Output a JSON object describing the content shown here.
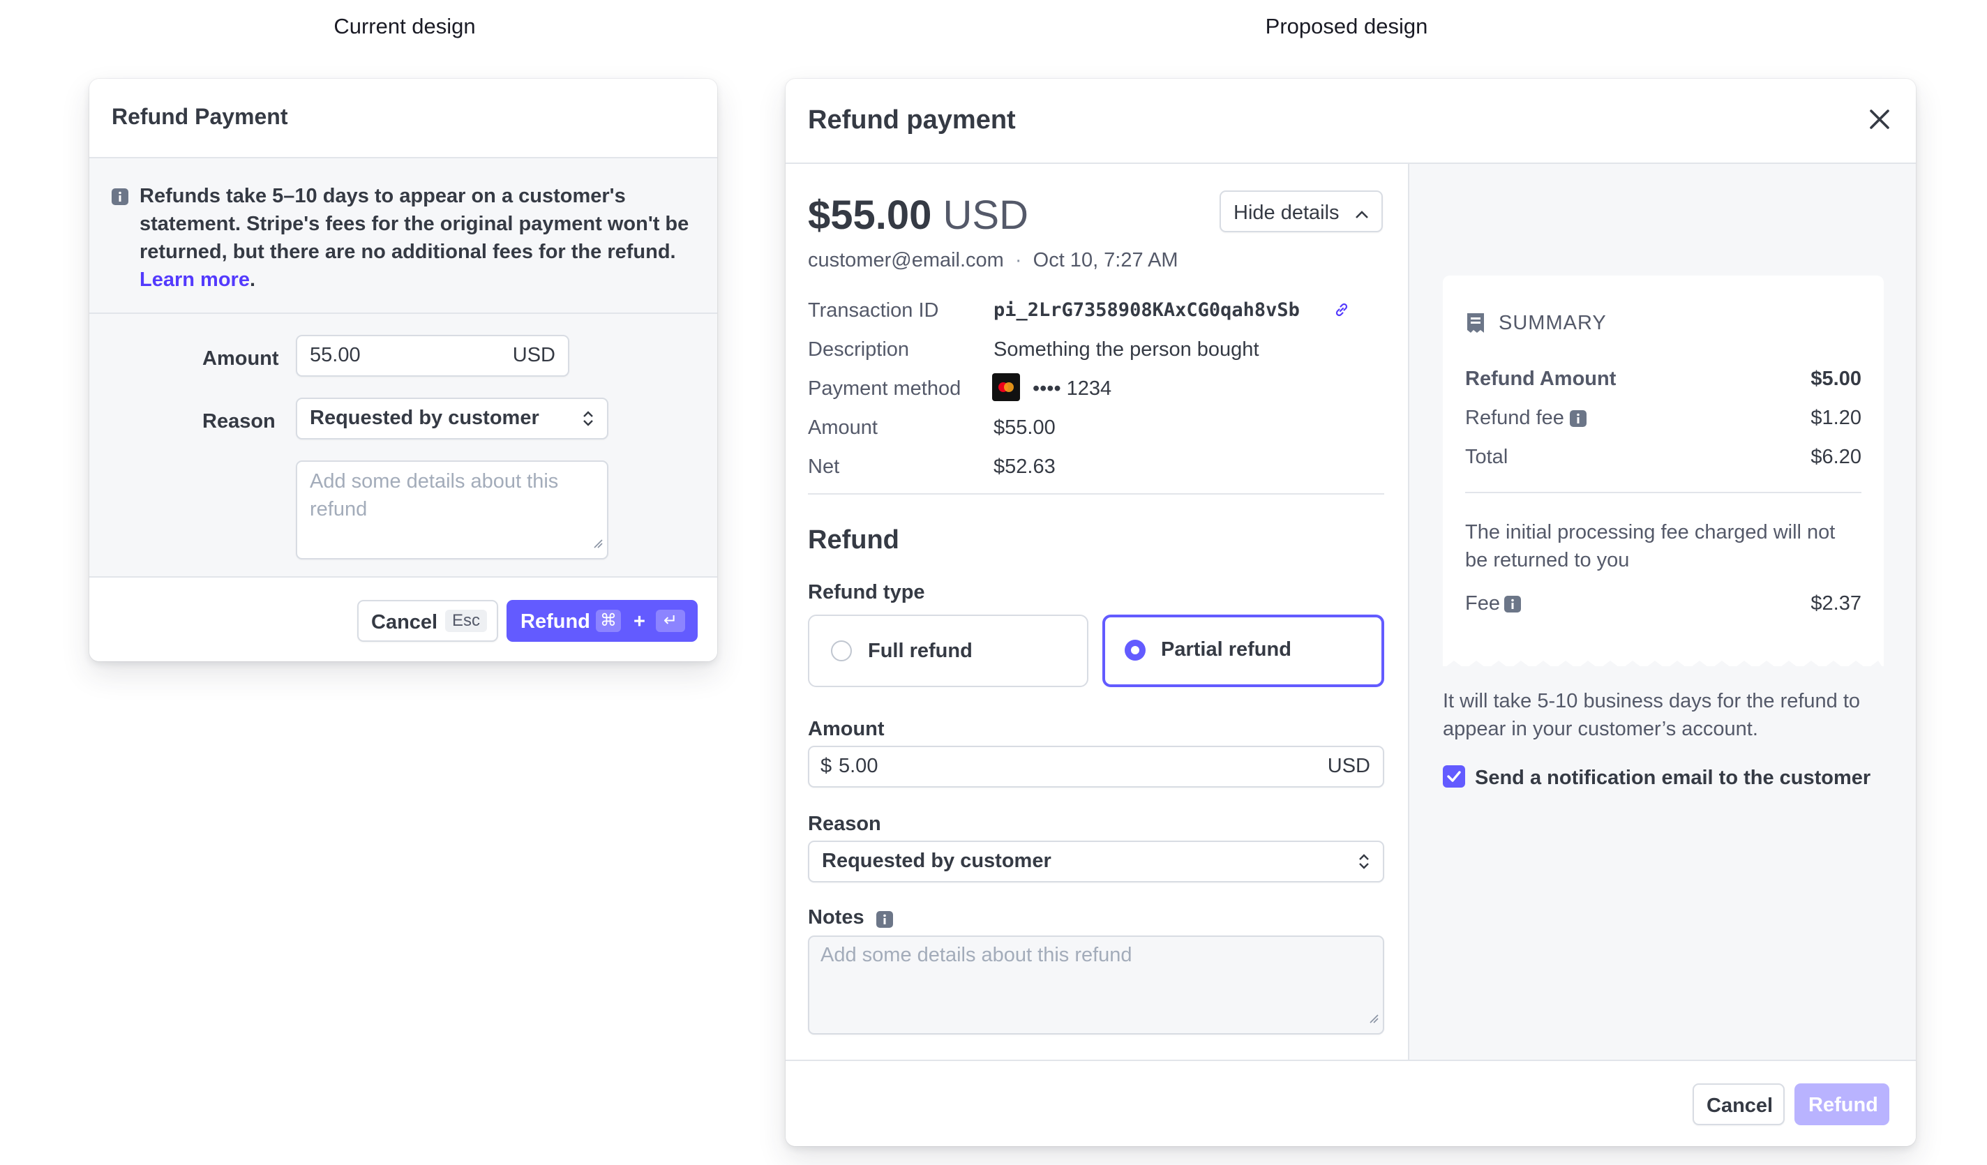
{
  "captions": {
    "current": "Current design",
    "proposed": "Proposed design"
  },
  "current": {
    "title": "Refund Payment",
    "notice": "Refunds take 5–10 days to appear on a customer's statement. Stripe's fees for the original payment won't be returned, but there are no additional fees for the refund.",
    "learn_more": "Learn more",
    "period": ".",
    "amount_label": "Amount",
    "amount_value": "55.00",
    "amount_unit": "USD",
    "reason_label": "Reason",
    "reason_value": "Requested by customer",
    "notes_placeholder": "Add some details about this refund",
    "cancel_label": "Cancel",
    "cancel_kbd": "Esc",
    "refund_label": "Refund",
    "refund_kbd_cmd": "⌘",
    "refund_kbd_plus": "+",
    "refund_kbd_enter": "↵"
  },
  "proposed": {
    "title": "Refund payment",
    "amount_main": "$55.00",
    "amount_currency": "USD",
    "hide_details": "Hide details",
    "customer_email": "customer@email.com",
    "dot": "·",
    "date": "Oct 10, 7:27 AM",
    "details": [
      {
        "key": "Transaction ID",
        "value": "pi_2LrG7358908KAxCG0qah8vSb"
      },
      {
        "key": "Description",
        "value": "Something the person bought"
      },
      {
        "key": "Payment method",
        "value": "•••• 1234"
      },
      {
        "key": "Amount",
        "value": "$55.00"
      },
      {
        "key": "Net",
        "value": "$52.63"
      }
    ],
    "refund_heading": "Refund",
    "refund_type_label": "Refund type",
    "full_refund": "Full refund",
    "partial_refund": "Partial refund",
    "selected_type": "partial",
    "amount_label": "Amount",
    "amount_prefix": "$",
    "amount_value": "5.00",
    "amount_unit": "USD",
    "reason_label": "Reason",
    "reason_value": "Requested by customer",
    "notes_label": "Notes",
    "notes_placeholder": "Add some details about this refund",
    "summary": {
      "heading": "SUMMARY",
      "rows": [
        {
          "key": "Refund Amount",
          "value": "$5.00"
        },
        {
          "key": "Refund fee",
          "value": "$1.20"
        },
        {
          "key": "Total",
          "value": "$6.20"
        }
      ],
      "fee_note": "The initial processing fee charged will not be returned to you",
      "fee_label": "Fee",
      "fee_value": "$2.37"
    },
    "timing_note": "It will take 5-10 business days for the refund to appear in your customer’s account.",
    "notify_label": "Send a notification email to the customer",
    "notify_checked": true,
    "cancel_label": "Cancel",
    "refund_label": "Refund"
  },
  "colors": {
    "accent": "#635bff",
    "link": "#533afd",
    "disabled_button": "#b9b3ff",
    "text": "#353a44",
    "muted": "#545969"
  }
}
